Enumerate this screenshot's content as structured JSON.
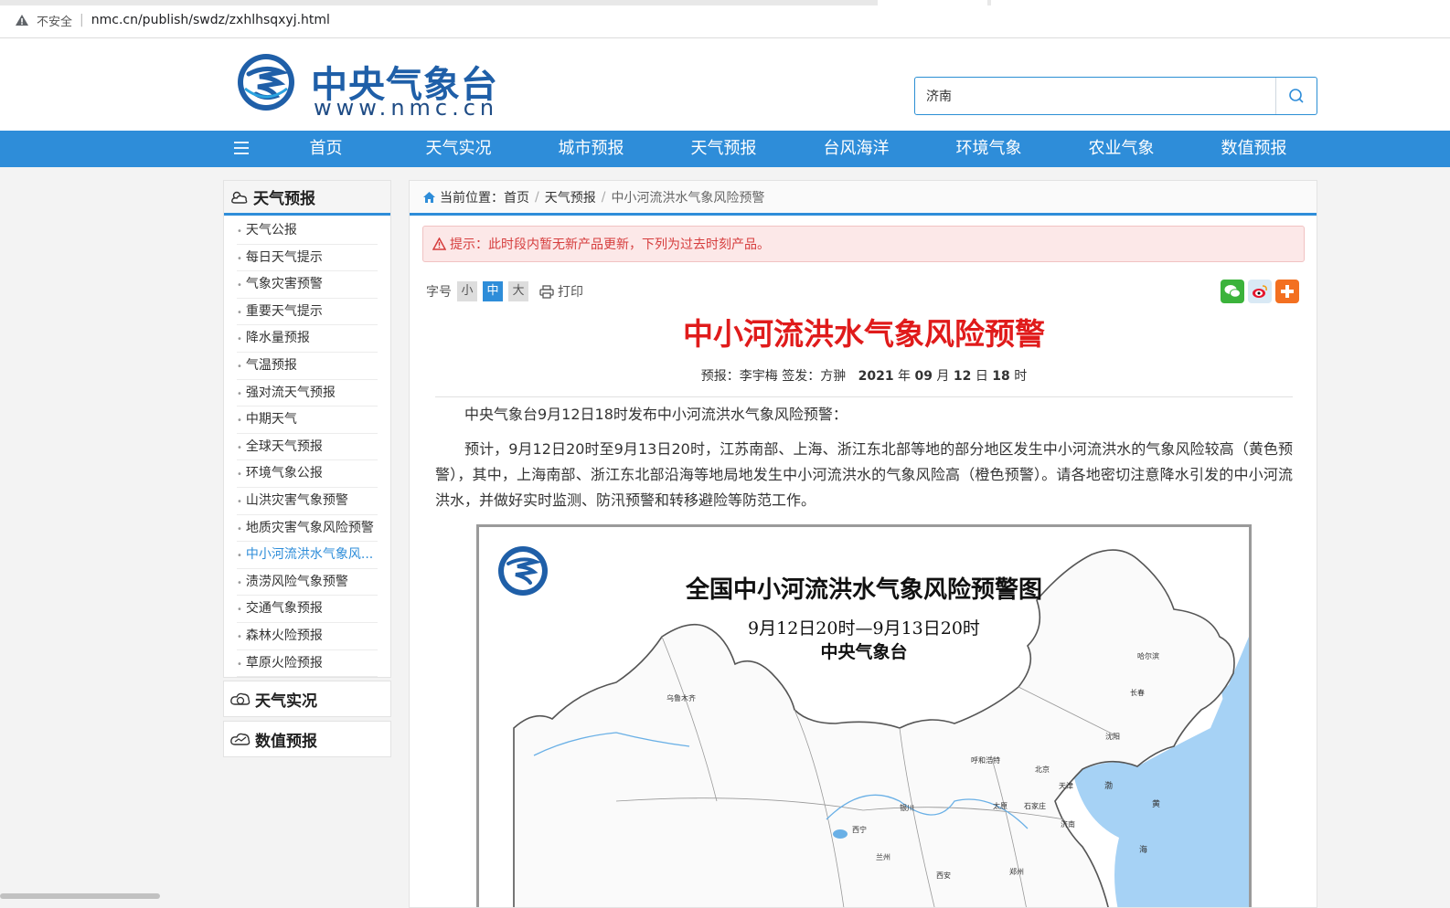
{
  "browser": {
    "security_label": "不安全",
    "url": "nmc.cn/publish/swdz/zxhlhsqxyj.html"
  },
  "header": {
    "logo_cn": "中央气象台",
    "logo_en": "www.nmc.cn",
    "search_value": "济南",
    "search_icon": "search-icon"
  },
  "nav": {
    "items": [
      "首页",
      "天气实况",
      "城市预报",
      "天气预报",
      "台风海洋",
      "环境气象",
      "农业气象",
      "数值预报"
    ]
  },
  "sidebar": {
    "main_title": "天气预报",
    "items": [
      "天气公报",
      "每日天气提示",
      "气象灾害预警",
      "重要天气提示",
      "降水量预报",
      "气温预报",
      "强对流天气预报",
      "中期天气",
      "全球天气预报",
      "环境气象公报",
      "山洪灾害气象预警",
      "地质灾害气象风险预警",
      "中小河流洪水气象风...",
      "渍涝风险气象预警",
      "交通气象预报",
      "森林火险预报",
      "草原火险预报"
    ],
    "active_index": 12,
    "box2_title": "天气实况",
    "box3_title": "数值预报"
  },
  "breadcrumb": {
    "prefix": "当前位置：",
    "items": [
      "首页",
      "天气预报",
      "中小河流洪水气象风险预警"
    ]
  },
  "alert": {
    "text": "提示：此时段内暂无新产品更新，下列为过去时刻产品。"
  },
  "tools": {
    "font_label": "字号",
    "sizes": [
      "小",
      "中",
      "大"
    ],
    "print_label": "打印"
  },
  "article": {
    "title": "中小河流洪水气象风险预警",
    "meta_forecast": "预报：李宇梅  签发：方翀",
    "meta_year": "2021",
    "meta_month": "09",
    "meta_day": "12",
    "meta_hour": "18",
    "unit_year": "年",
    "unit_month": "月",
    "unit_day": "日",
    "unit_hour": "时",
    "para1": "中央气象台9月12日18时发布中小河流洪水气象风险预警：",
    "para2": "预计，9月12日20时至9月13日20时，江苏南部、上海、浙江东北部等地的部分地区发生中小河流洪水的气象风险较高（黄色预警），其中，上海南部、浙江东北部沿海等地局地发生中小河流洪水的气象风险高（橙色预警）。请各地密切注意降水引发的中小河流洪水，并做好实时监测、防汛预警和转移避险等防范工作。"
  },
  "map": {
    "title": "全国中小河流洪水气象风险预警图",
    "subtitle": "9月12日20时—9月13日20时",
    "org": "中央气象台",
    "cities": [
      "乌鲁木齐",
      "哈尔滨",
      "长春",
      "沈阳",
      "呼和浩特",
      "北京",
      "天津",
      "石家庄",
      "太原",
      "银川",
      "西宁",
      "兰州",
      "济南",
      "郑州",
      "西安"
    ],
    "sea_labels": [
      "渤",
      "黄",
      "海"
    ]
  },
  "colors": {
    "nav_blue": "#2e8dd9",
    "title_red": "#e01b1b",
    "logo_blue": "#1f5fa8",
    "sea_blue": "#a6d2f5"
  }
}
